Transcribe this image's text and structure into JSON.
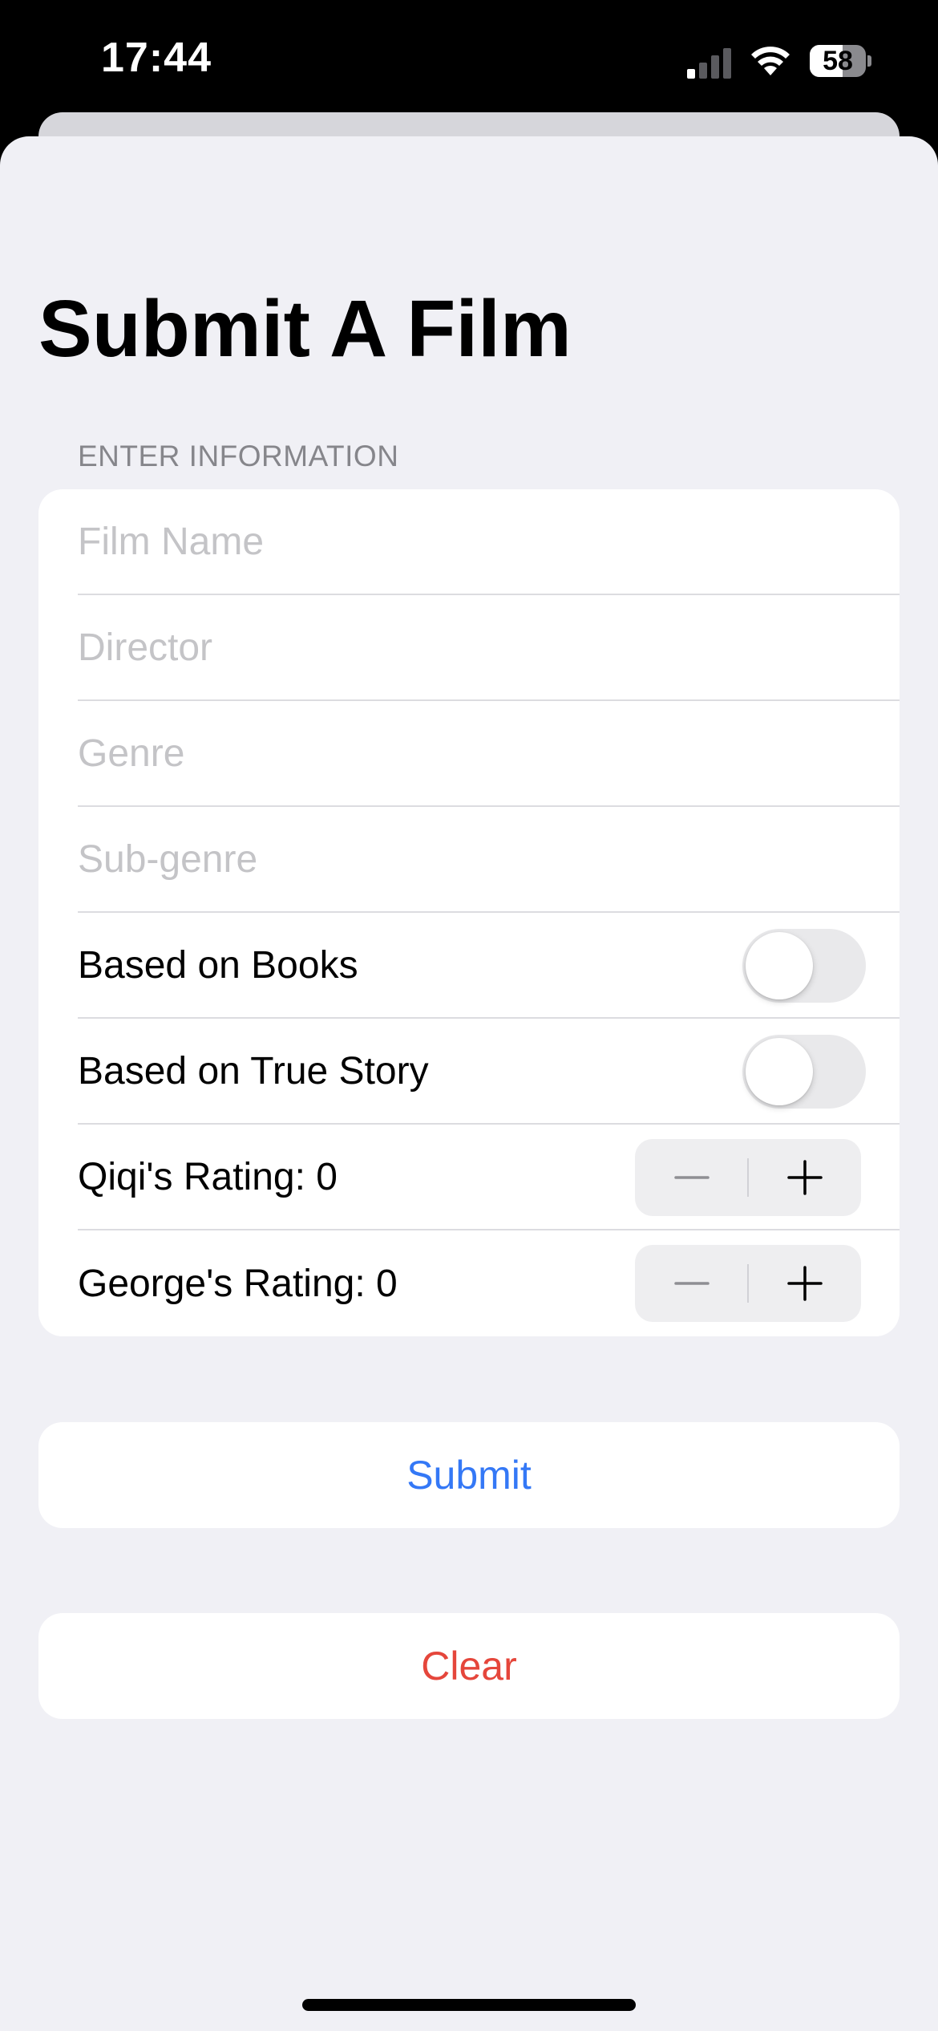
{
  "status_bar": {
    "time": "17:44",
    "battery_level": "58",
    "battery_fraction": 0.58,
    "signal_bars_active": 1,
    "icons": [
      "signal-icon",
      "wifi-icon",
      "battery-icon"
    ]
  },
  "page": {
    "title": "Submit A Film"
  },
  "form": {
    "section_header": "ENTER INFORMATION",
    "fields": [
      {
        "placeholder": "Film Name",
        "value": ""
      },
      {
        "placeholder": "Director",
        "value": ""
      },
      {
        "placeholder": "Genre",
        "value": ""
      },
      {
        "placeholder": "Sub-genre",
        "value": ""
      }
    ],
    "toggles": [
      {
        "label": "Based on Books",
        "on": false
      },
      {
        "label": "Based on True Story",
        "on": false
      }
    ],
    "ratings": [
      {
        "label": "Qiqi's Rating: 0",
        "value": 0
      },
      {
        "label": "George's Rating: 0",
        "value": 0
      }
    ],
    "stepper_minus": "−",
    "stepper_plus": "+"
  },
  "actions": {
    "submit_label": "Submit",
    "clear_label": "Clear"
  },
  "colors": {
    "accent": "#3478f6",
    "destructive": "#e5463b",
    "background": "#f0f0f5"
  }
}
